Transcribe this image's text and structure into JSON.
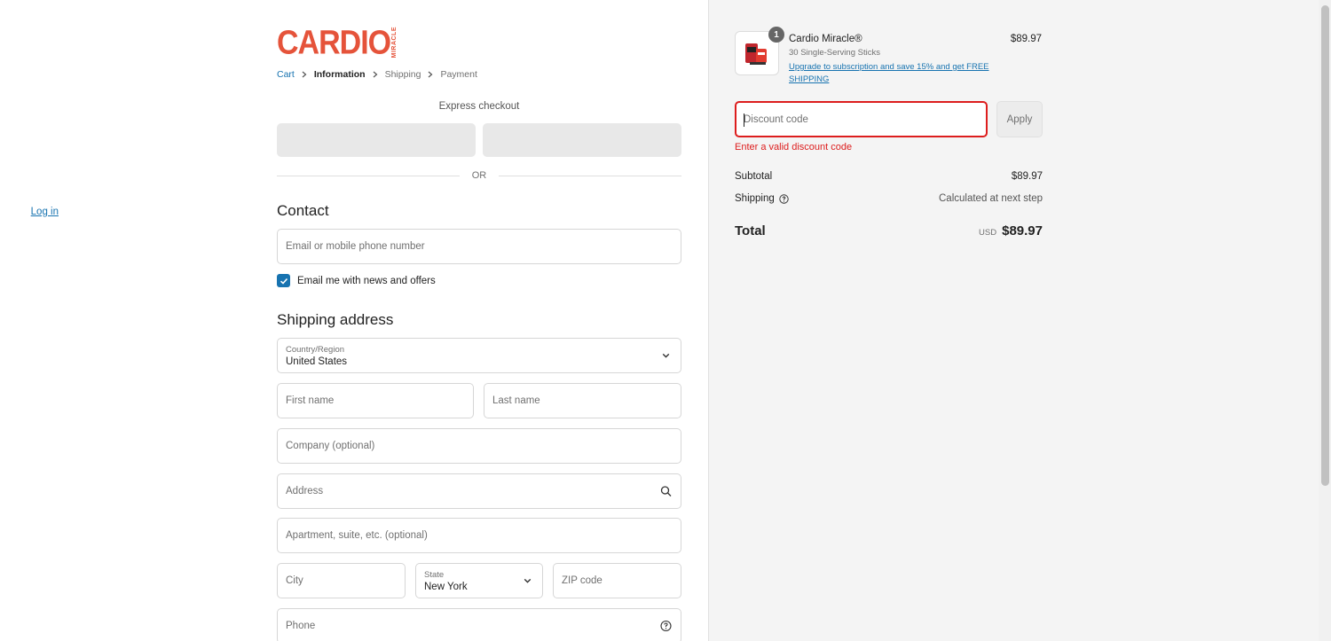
{
  "brand": {
    "logo_text": "CARDIO",
    "logo_sub": "MIRACLE"
  },
  "breadcrumb": [
    "Cart",
    "Information",
    "Shipping",
    "Payment"
  ],
  "express": {
    "label": "Express checkout",
    "or": "OR"
  },
  "contact": {
    "heading": "Contact",
    "login": "Log in",
    "email_placeholder": "Email or mobile phone number",
    "news_label": "Email me with news and offers",
    "news_checked": true
  },
  "shipping": {
    "heading": "Shipping address",
    "country_label": "Country/Region",
    "country_value": "United States",
    "first_name": "First name",
    "last_name": "Last name",
    "company": "Company (optional)",
    "address": "Address",
    "apartment": "Apartment, suite, etc. (optional)",
    "city": "City",
    "state_label": "State",
    "state_value": "New York",
    "zip": "ZIP code",
    "phone": "Phone"
  },
  "order": {
    "quantity": "1",
    "product_name": "Cardio Miracle®",
    "product_sub": "30 Single-Serving Sticks",
    "upgrade": "Upgrade to subscription and save 15% and get FREE SHIPPING",
    "product_price": "$89.97",
    "discount_placeholder": "Discount code",
    "apply": "Apply",
    "discount_error": "Enter a valid discount code",
    "subtotal_label": "Subtotal",
    "subtotal_value": "$89.97",
    "shipping_label": "Shipping",
    "shipping_value": "Calculated at next step",
    "total_label": "Total",
    "total_currency": "USD",
    "total_value": "$89.97"
  },
  "colors": {
    "accent": "#1773b0",
    "brand": "#e5533a",
    "error": "#dd1d1d"
  }
}
